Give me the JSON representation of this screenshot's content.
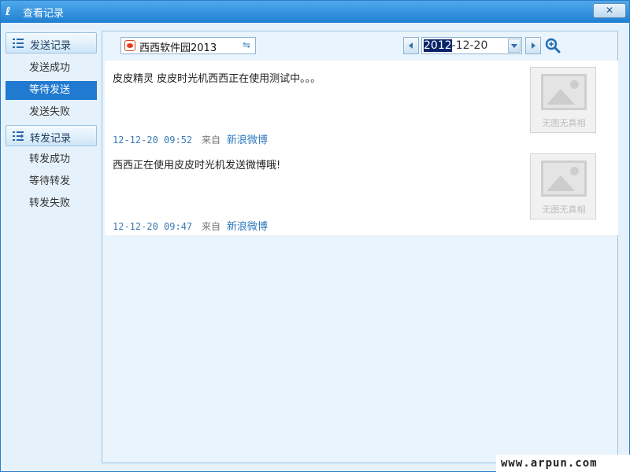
{
  "window": {
    "title": "查看记录",
    "close_label": "✕"
  },
  "sidebar": {
    "sections": [
      {
        "label": "发送记录",
        "items": [
          "发送成功",
          "等待发送",
          "发送失败"
        ]
      },
      {
        "label": "转发记录",
        "items": [
          "转发成功",
          "等待转发",
          "转发失败"
        ]
      }
    ],
    "active_item": "等待发送"
  },
  "toolbar": {
    "account": "西西软件园2013",
    "swap_glyph": "⇋",
    "date_year": "2012",
    "date_rest": "-12-20"
  },
  "posts": [
    {
      "text": "皮皮精灵 皮皮时光机西西正在使用测试中。。。",
      "time": "12-12-20 09:52",
      "from_label": "来自",
      "source": "新浪微博",
      "thumb_caption": "无图无真相"
    },
    {
      "text": "西西正在使用皮皮时光机发送微博哦!",
      "time": "12-12-20 09:47",
      "from_label": "来自",
      "source": "新浪微博",
      "thumb_caption": "无图无真相"
    }
  ],
  "watermark": "www.arpun.com"
}
